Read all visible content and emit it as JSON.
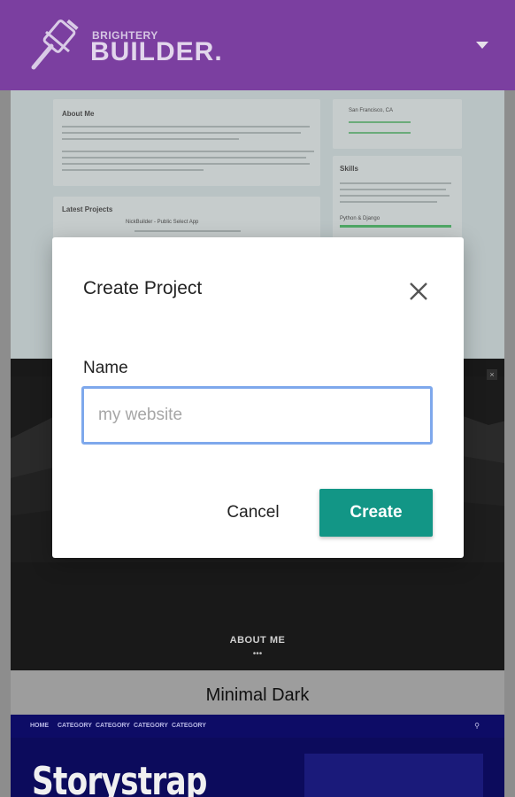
{
  "header": {
    "brand_small": "BRIGHTERY",
    "brand_big": "BUILDER.",
    "logo_icon": "gavel-icon",
    "menu_icon": "caret-down-icon",
    "color": "#7b3fa0"
  },
  "templates": [
    {
      "preview_sections": [
        "About Me",
        "Latest Projects",
        "Skills"
      ],
      "preview_snippets": [
        "San Francisco, CA",
        "NickBuilder - Public Select App",
        "Python & Django"
      ]
    },
    {
      "name": "Minimal Dark",
      "preview_heading": "ABOUT ME",
      "preview_dots": "•••"
    },
    {
      "preview_nav": [
        "HOME",
        "CATEGORY",
        "CATEGORY",
        "CATEGORY",
        "CATEGORY"
      ],
      "preview_title": "Storystrap"
    }
  ],
  "modal": {
    "title": "Create Project",
    "close_icon": "close-icon",
    "name_label": "Name",
    "name_placeholder": "my website",
    "name_value": "",
    "cancel_label": "Cancel",
    "create_label": "Create",
    "create_color": "#129686"
  }
}
